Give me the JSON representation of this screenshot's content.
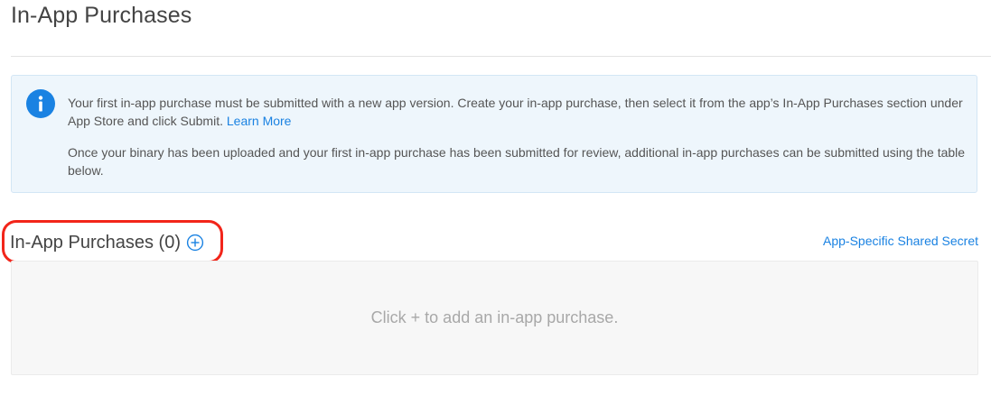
{
  "page": {
    "title": "In-App Purchases"
  },
  "info_box": {
    "icon": "info-icon",
    "paragraph1": "Your first in-app purchase must be submitted with a new app version. Create your in-app purchase, then select it from the app’s In-App Purchases section under App Store and click Submit.",
    "learn_more_label": "Learn More",
    "paragraph2": "Once your binary has been uploaded and your first in-app purchase has been submitted for review, additional in-app purchases can be submitted using the table below."
  },
  "section": {
    "title": "In-App Purchases (0)",
    "add_icon": "plus-circle-icon",
    "shared_secret_label": "App-Specific Shared Secret",
    "empty_message": "Click + to add an in-app purchase."
  },
  "colors": {
    "accent": "#1a82e2",
    "info_background": "#eef6fc",
    "highlight": "#f2251a",
    "empty_panel": "#f7f7f7"
  }
}
